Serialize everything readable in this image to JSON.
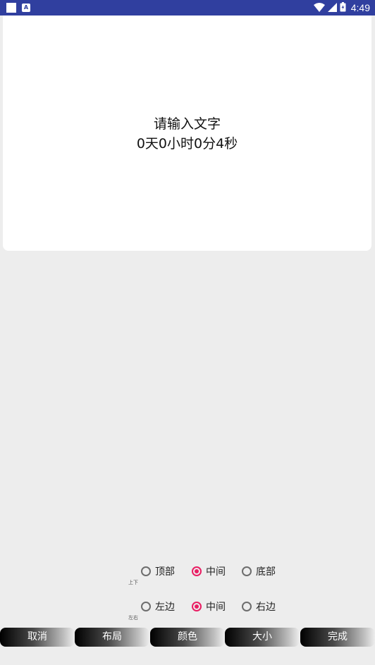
{
  "status_bar": {
    "time": "4:49",
    "app_icon_letter": "A",
    "icons": [
      "notification-square-icon",
      "app-notification-icon",
      "wifi-icon",
      "cellular-signal-icon",
      "battery-icon"
    ]
  },
  "preview": {
    "line1": "请输入文字",
    "line2": "0天0小时0分4秒"
  },
  "vertical_row": {
    "label": "上下",
    "options": [
      {
        "label": "顶部",
        "checked": false
      },
      {
        "label": "中间",
        "checked": true
      },
      {
        "label": "底部",
        "checked": false
      }
    ]
  },
  "horizontal_row": {
    "label": "左右",
    "options": [
      {
        "label": "左边",
        "checked": false
      },
      {
        "label": "中间",
        "checked": true
      },
      {
        "label": "右边",
        "checked": false
      }
    ]
  },
  "bottom_bar": {
    "buttons": [
      "取消",
      "布局",
      "颜色",
      "大小",
      "完成"
    ]
  },
  "colors": {
    "status_bar": "#303f9f",
    "accent": "#e91e63",
    "background": "#ededed"
  }
}
